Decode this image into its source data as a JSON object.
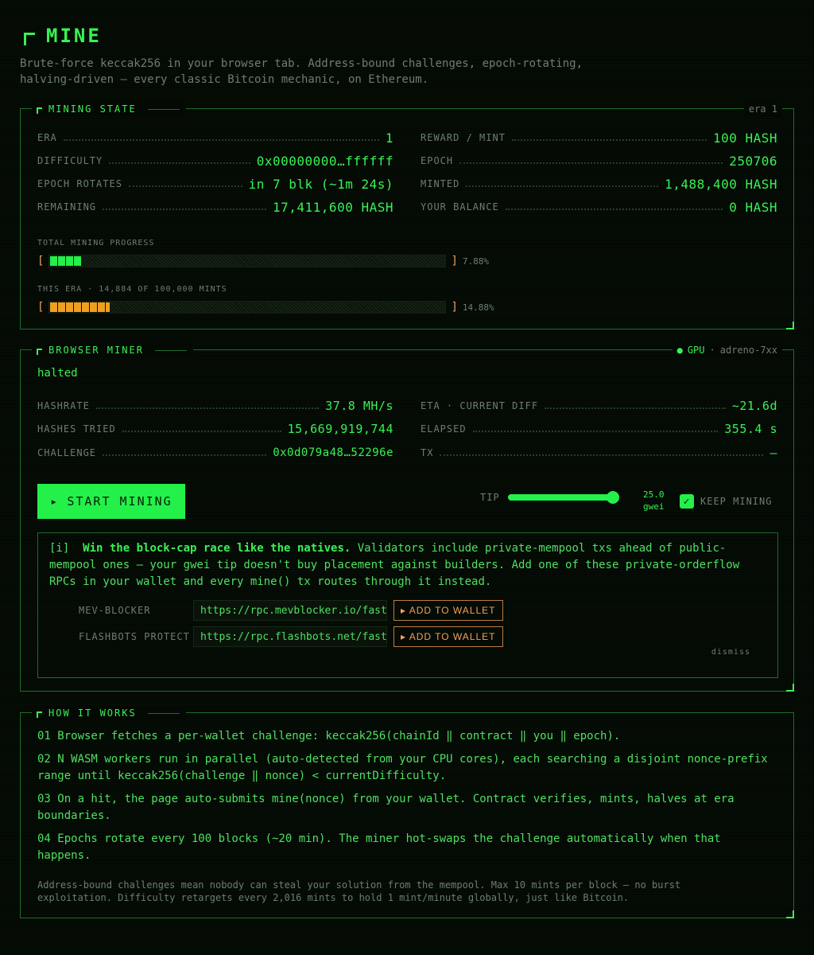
{
  "header": {
    "title": "MINE",
    "subtitle": "Brute-force keccak256 in your browser tab. Address-bound challenges, epoch-rotating, halving-driven — every classic Bitcoin mechanic, on Ethereum."
  },
  "mining_state": {
    "title": "MINING STATE",
    "era_badge": "era 1",
    "left": [
      {
        "label": "ERA",
        "value": "1"
      },
      {
        "label": "DIFFICULTY",
        "value": "0x00000000…ffffff"
      },
      {
        "label": "EPOCH ROTATES",
        "value": "in 7 blk (~1m 24s)"
      },
      {
        "label": "REMAINING",
        "value": "17,411,600 HASH"
      }
    ],
    "right": [
      {
        "label": "REWARD / MINT",
        "value": "100 HASH"
      },
      {
        "label": "EPOCH",
        "value": "250706"
      },
      {
        "label": "MINTED",
        "value": "1,488,400 HASH"
      },
      {
        "label": "YOUR BALANCE",
        "value": "0 HASH"
      }
    ],
    "total_progress": {
      "label": "TOTAL MINING PROGRESS",
      "bracket_open": "[",
      "bracket_close": "]",
      "percent_text": "7.88%",
      "fraction": 0.0788
    },
    "era_progress": {
      "label": "THIS ERA · 14,884 OF 100,000 MINTS",
      "bracket_open": "[",
      "bracket_close": "]",
      "percent_text": "14.88%",
      "fraction": 0.1488
    }
  },
  "browser_miner": {
    "title": "BROWSER MINER",
    "gpu_dot": "●",
    "gpu_label": "GPU",
    "gpu_sep": "·",
    "gpu_name": "adreno-7xx",
    "status": "halted",
    "left": [
      {
        "label": "HASHRATE",
        "value": "37.8 MH/s"
      },
      {
        "label": "HASHES TRIED",
        "value": "15,669,919,744"
      },
      {
        "label": "CHALLENGE",
        "value": "0x0d079a48…52296e"
      }
    ],
    "right": [
      {
        "label": "ETA · CURRENT DIFF",
        "value": "~21.6d"
      },
      {
        "label": "ELAPSED",
        "value": "355.4 s"
      },
      {
        "label": "TX",
        "value": "—"
      }
    ],
    "start_button": {
      "icon": "▸",
      "label": "START MINING"
    },
    "tip": {
      "label": "TIP",
      "value": "25.0",
      "unit": "gwei",
      "level": 1.0
    },
    "keep_mining": {
      "label": "KEEP MINING",
      "checked": true,
      "check_glyph": "✓"
    },
    "info": {
      "prefix": "[i]",
      "headline": "Win the block-cap race like the natives.",
      "body": "Validators include private-mempool txs ahead of public-mempool ones — your gwei tip doesn't buy placement against builders. Add one of these private-orderflow RPCs in your wallet and every mine() tx routes through it instead.",
      "rpcs": [
        {
          "name": "MEV-BLOCKER",
          "url": "https://rpc.mevblocker.io/fast",
          "button": "▸ ADD TO WALLET"
        },
        {
          "name": "FLASHBOTS PROTECT",
          "url": "https://rpc.flashbots.net/fast",
          "button": "▸ ADD TO WALLET"
        }
      ],
      "dismiss": "dismiss"
    }
  },
  "how_it_works": {
    "title": "HOW IT WORKS",
    "steps": [
      "01 Browser fetches a per-wallet challenge: keccak256(chainId ‖ contract ‖ you ‖ epoch).",
      "02 N WASM workers run in parallel (auto-detected from your CPU cores), each searching a disjoint nonce-prefix range until keccak256(challenge ‖ nonce) < currentDifficulty.",
      "03 On a hit, the page auto-submits mine(nonce) from your wallet. Contract verifies, mints, halves at era boundaries.",
      "04 Epochs rotate every 100 blocks (~20 min). The miner hot-swaps the challenge automatically when that happens."
    ],
    "footnote": "Address-bound challenges mean nobody can steal your solution from the mempool. Max 10 mints per block — no burst exploitation. Difficulty retargets every 2,016 mints to hold 1 mint/minute globally, just like Bitcoin."
  },
  "colors": {
    "accent": "#39f154",
    "warning": "#f0a05c",
    "muted": "#6e7e70",
    "border": "#1f6b2a"
  }
}
